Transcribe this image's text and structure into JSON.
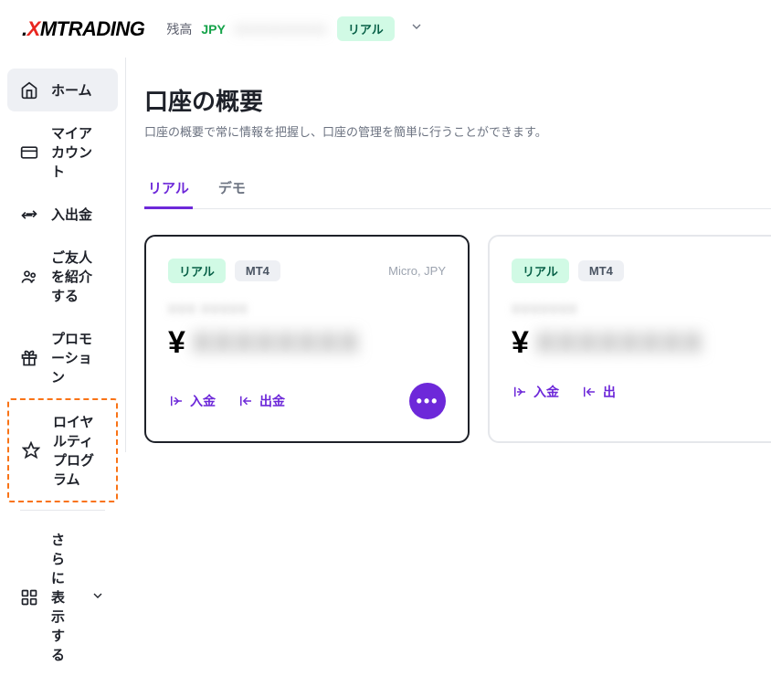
{
  "header": {
    "logo_prefix": "X",
    "logo_main": "MTRADING",
    "balance_label": "残高",
    "currency": "JPY",
    "account_type": "リアル"
  },
  "sidebar": {
    "items": [
      {
        "label": "ホーム"
      },
      {
        "label": "マイアカウント"
      },
      {
        "label": "入出金"
      },
      {
        "label": "ご友人を紹介する"
      },
      {
        "label": "プロモーション"
      },
      {
        "label": "ロイヤルティプログラム"
      }
    ],
    "more_label": "さらに表示する"
  },
  "main": {
    "title": "口座の概要",
    "subtitle": "口座の概要で常に情報を把握し、口座の管理を簡単に行うことができます。",
    "tabs": [
      {
        "label": "リアル"
      },
      {
        "label": "デモ"
      }
    ]
  },
  "cards": [
    {
      "type_badge": "リアル",
      "platform_badge": "MT4",
      "meta": "Micro, JPY",
      "currency_symbol": "¥",
      "deposit_label": "入金",
      "withdraw_label": "出金"
    },
    {
      "type_badge": "リアル",
      "platform_badge": "MT4",
      "currency_symbol": "¥",
      "deposit_label": "入金",
      "withdraw_label": "出"
    }
  ]
}
